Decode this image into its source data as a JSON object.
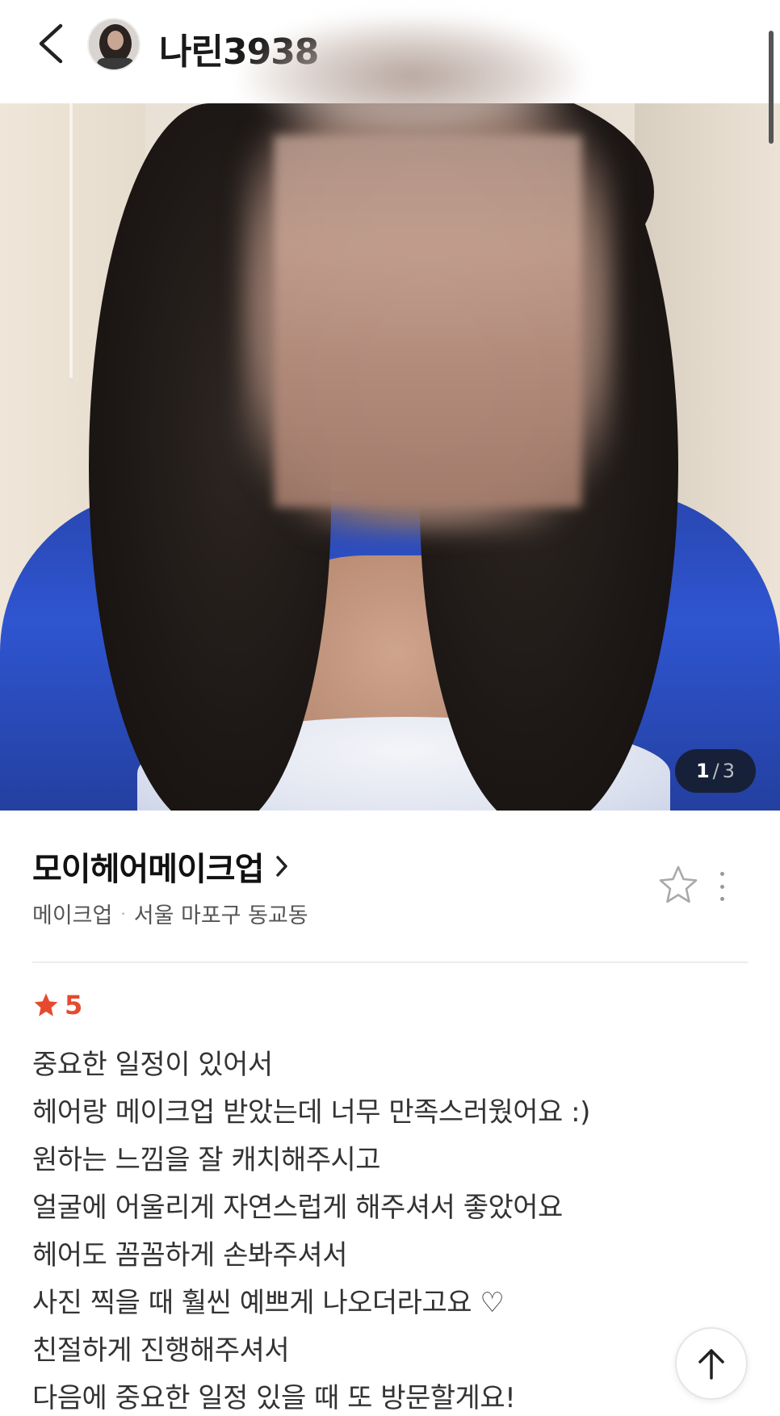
{
  "header": {
    "username": "나린3938",
    "back_icon": "chevron-left-icon",
    "avatar_alt": "profile-photo"
  },
  "photo": {
    "current": "1",
    "separator": "/",
    "total": "3"
  },
  "shop": {
    "name": "모이헤어메이크업",
    "category": "메이크업",
    "dot": "·",
    "location": "서울 마포구 동교동",
    "favorite_icon": "star-outline-icon",
    "more_icon": "more-vertical-icon"
  },
  "review": {
    "rating": "5",
    "rating_color": "#e54a2e",
    "lines": [
      "중요한 일정이 있어서",
      "헤어랑 메이크업 받았는데 너무 만족스러웠어요 :)",
      "원하는 느낌을 잘 캐치해주시고",
      "얼굴에 어울리게 자연스럽게 해주셔서 좋았어요",
      "헤어도 꼼꼼하게 손봐주셔서",
      "사진 찍을 때 훨씬 예쁘게 나오더라고요 ♡",
      "친절하게 진행해주셔서",
      "다음에 중요한 일정 있을 때 또 방문할게요!"
    ]
  },
  "scroll_top_icon": "arrow-up-icon"
}
